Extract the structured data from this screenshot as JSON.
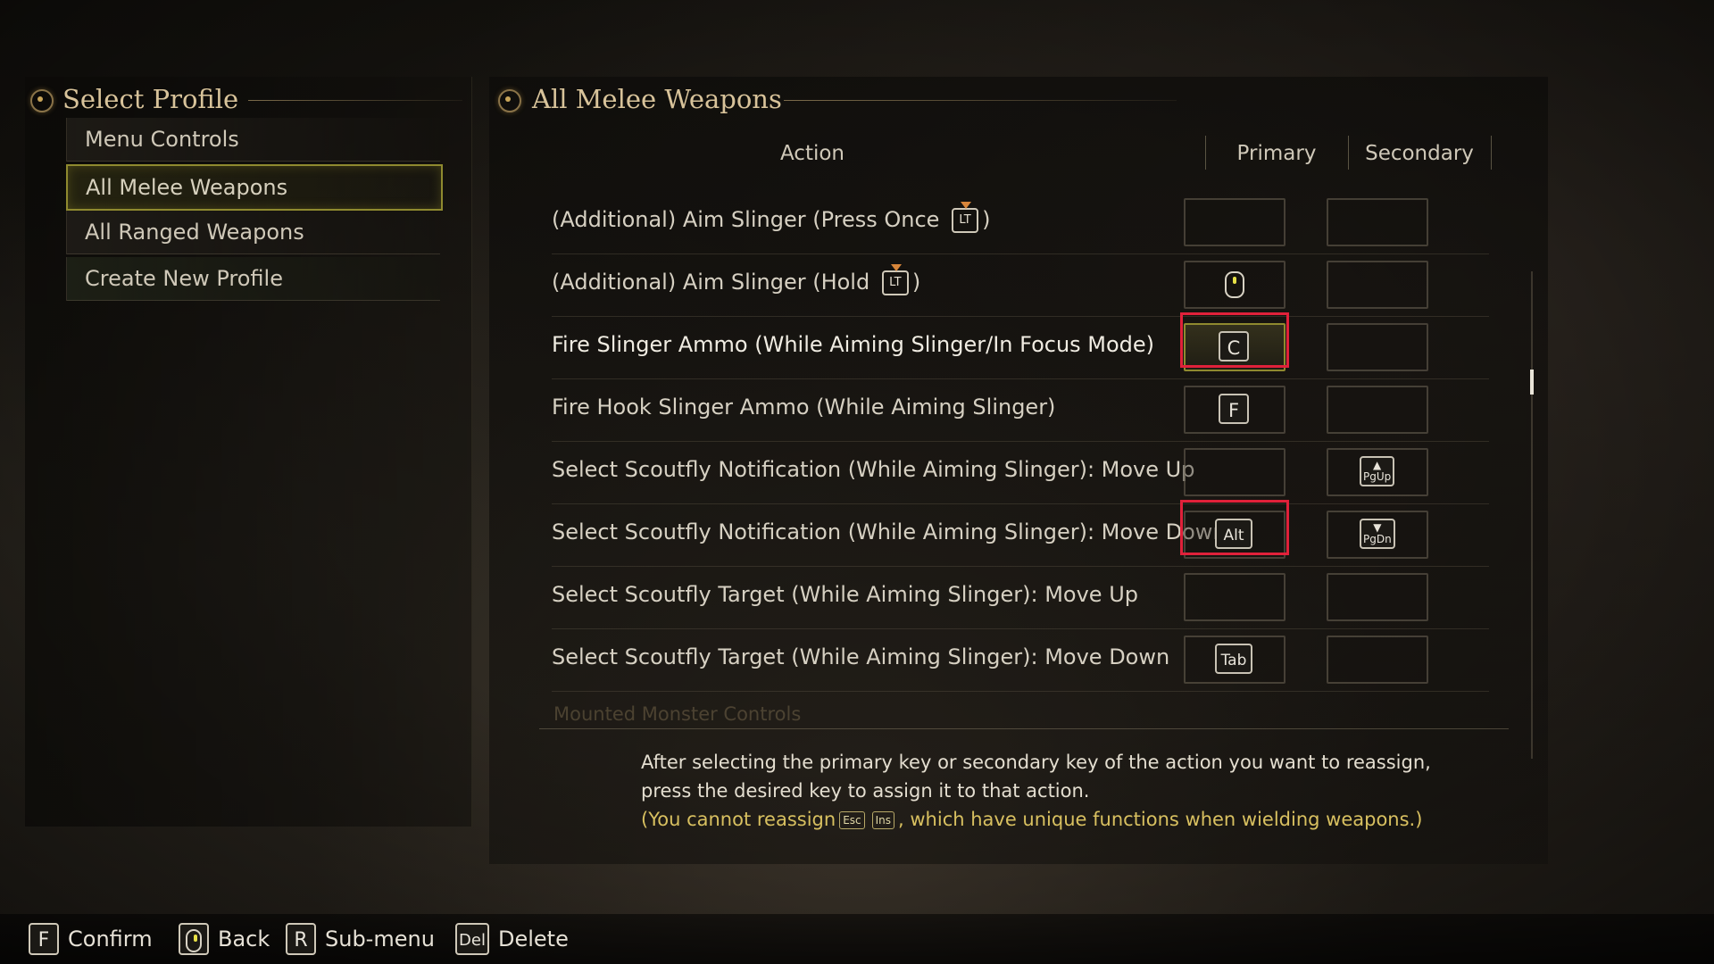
{
  "left": {
    "title": "Select Profile",
    "items": [
      {
        "label": "Menu Controls"
      },
      {
        "label": "All Melee Weapons"
      },
      {
        "label": "All Ranged Weapons"
      },
      {
        "label": "Create New Profile"
      }
    ],
    "active_index": 1
  },
  "right": {
    "title": "All Melee Weapons",
    "columns": {
      "action": "Action",
      "primary": "Primary",
      "secondary": "Secondary"
    },
    "rows": [
      {
        "pre": "(Additional) Aim Slinger (Press Once ",
        "icon": "LT",
        "post": ")",
        "primary": "",
        "secondary": ""
      },
      {
        "pre": "(Additional) Aim Slinger (Hold ",
        "icon": "LT",
        "post": ")",
        "primary": "mouse-icon",
        "secondary": ""
      },
      {
        "action": "Fire Slinger Ammo (While Aiming Slinger/In Focus Mode)",
        "primary": "C",
        "secondary": "",
        "highlight": true
      },
      {
        "action": "Fire Hook Slinger Ammo (While Aiming Slinger)",
        "primary": "F",
        "secondary": ""
      },
      {
        "action": "Select Scoutfly Notification (While Aiming Slinger): Move Up",
        "primary": "",
        "secondary": "PgUp"
      },
      {
        "action": "Select Scoutfly Notification (While Aiming Slinger): Move Down",
        "primary": "Alt",
        "secondary": "PgDn",
        "highlight": true
      },
      {
        "action": "Select Scoutfly Target (While Aiming Slinger): Move Up",
        "primary": "",
        "secondary": ""
      },
      {
        "action": "Select Scoutfly Target (While Aiming Slinger): Move Down",
        "primary": "Tab",
        "secondary": ""
      }
    ],
    "faded_section": "Mounted Monster Controls",
    "help_line1": "After selecting the primary key or secondary key of the action you want to reassign,",
    "help_line2": "press the desired key to assign it to that action.",
    "warn_pre": "(You cannot reassign",
    "warn_key1": "Esc",
    "warn_key2": "Ins",
    "warn_post": ", which have unique functions when wielding weapons.)"
  },
  "bottom": {
    "confirm_key": "F",
    "confirm_label": "Confirm",
    "back_icon": "mouse-icon",
    "back_label": "Back",
    "submenu_key": "R",
    "submenu_label": "Sub-menu",
    "delete_key": "Del",
    "delete_label": "Delete"
  },
  "colors": {
    "highlight": "#e0213a",
    "accent": "#d8c39a",
    "warning": "#d8c060",
    "active_border": "#8f8a2f"
  }
}
